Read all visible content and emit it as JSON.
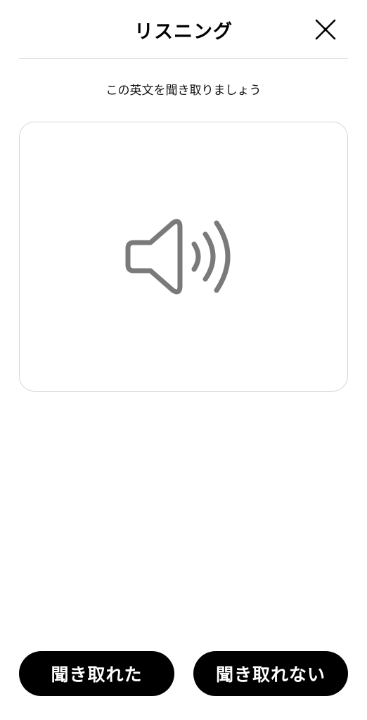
{
  "header": {
    "title": "リスニング",
    "close_icon": "close-icon"
  },
  "instruction": "この英文を聞き取りましょう",
  "audio_card": {
    "icon": "speaker-icon"
  },
  "actions": {
    "heard_label": "聞き取れた",
    "not_heard_label": "聞き取れない"
  },
  "colors": {
    "button_bg": "#000000",
    "button_text": "#ffffff",
    "icon_gray": "#7a7a7a",
    "divider": "#d8d8d8"
  }
}
